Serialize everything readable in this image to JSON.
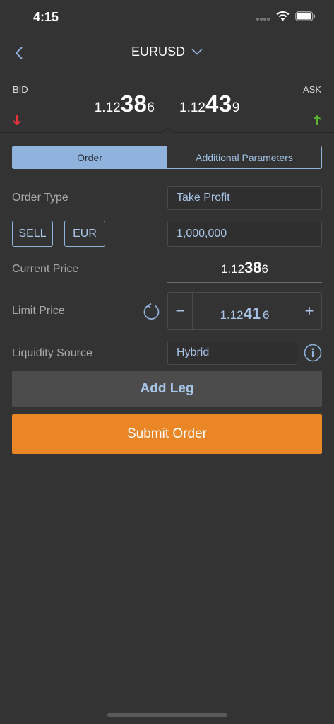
{
  "status_bar": {
    "time": "4:15"
  },
  "nav": {
    "title": "EURUSD"
  },
  "quotes": {
    "bid": {
      "label": "BID",
      "prefix": "1.12",
      "big": "38",
      "pip": "6",
      "direction": "down",
      "color": "#e8323c"
    },
    "ask": {
      "label": "ASK",
      "prefix": "1.12",
      "big": "43",
      "pip": "9",
      "direction": "up",
      "color": "#58b32f"
    }
  },
  "tabs": [
    {
      "label": "Order",
      "active": true
    },
    {
      "label": "Additional Parameters",
      "active": false
    }
  ],
  "form": {
    "order_type_label": "Order Type",
    "order_type_value": "Take Profit",
    "side_button": "SELL",
    "currency_button": "EUR",
    "amount_value": "1,000,000",
    "current_price_label": "Current Price",
    "current_price": {
      "prefix": "1.12",
      "big": "38",
      "pip": "6"
    },
    "limit_price_label": "Limit Price",
    "limit_price": {
      "prefix": "1.12",
      "big": "41",
      "pip": "6"
    },
    "stepper_minus": "−",
    "stepper_plus": "+",
    "liquidity_label": "Liquidity Source",
    "liquidity_value": "Hybrid"
  },
  "actions": {
    "add_leg": "Add Leg",
    "submit": "Submit Order"
  },
  "colors": {
    "accent": "#8fb3dd",
    "submit": "#ea8626",
    "background": "#333333"
  }
}
